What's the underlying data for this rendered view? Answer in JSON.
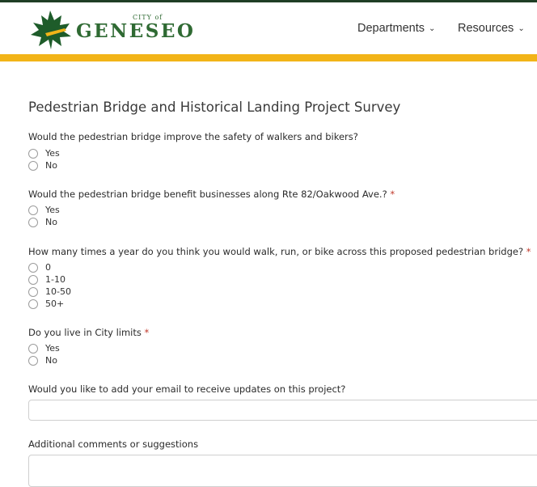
{
  "header": {
    "logo_small": "CITY of",
    "logo_big": "GENESEO",
    "nav": [
      {
        "label": "Departments"
      },
      {
        "label": "Resources"
      }
    ]
  },
  "colors": {
    "topline": "#1f3e25",
    "goldbar": "#f2b418",
    "brand_green": "#2f6a33",
    "required": "#c0392b"
  },
  "icons": {
    "logo": "maple-leaf-icon",
    "nav_chevron": "chevron-down-icon",
    "option": "radio-icon"
  },
  "survey": {
    "title": "Pedestrian Bridge and Historical Landing Project Survey",
    "q1": {
      "text": "Would the pedestrian bridge improve the safety of walkers and bikers?",
      "required": "",
      "options": [
        "Yes",
        "No"
      ]
    },
    "q2": {
      "text": "Would the pedestrian bridge benefit businesses along Rte 82/Oakwood Ave.?",
      "required": "*",
      "options": [
        "Yes",
        "No"
      ]
    },
    "q3": {
      "text": "How many times a year do you think you would walk, run, or bike across this proposed pedestrian bridge?",
      "required": "*",
      "options": [
        "0",
        "1-10",
        "10-50",
        "50+"
      ]
    },
    "q4": {
      "text": "Do you live in City limits",
      "required": "*",
      "options": [
        "Yes",
        "No"
      ]
    },
    "q5": {
      "text": "Would you like to add your email to receive updates on this project?",
      "value": ""
    },
    "q6": {
      "text": "Additional comments or suggestions",
      "value": ""
    }
  }
}
